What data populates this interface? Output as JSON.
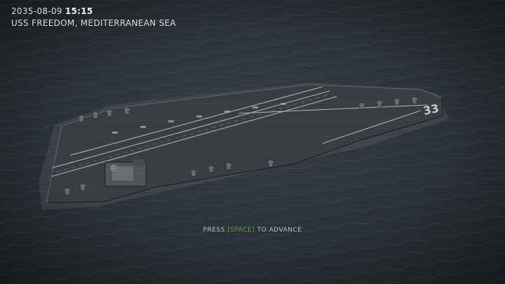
{
  "hud": {
    "date": "2035-08-09",
    "time": "15:15",
    "location": "USS FREEDOM, MEDITERRANEAN SEA"
  },
  "prompt": {
    "before": "PRESS ",
    "key": "[SPACE]",
    "after": " TO ADVANCE"
  },
  "ship": {
    "hull_number": "33"
  },
  "colors": {
    "sea": "#2f363c",
    "deck": "#3b3f42",
    "key_highlight": "#4fa84a",
    "hud_text": "#d9dde0"
  }
}
